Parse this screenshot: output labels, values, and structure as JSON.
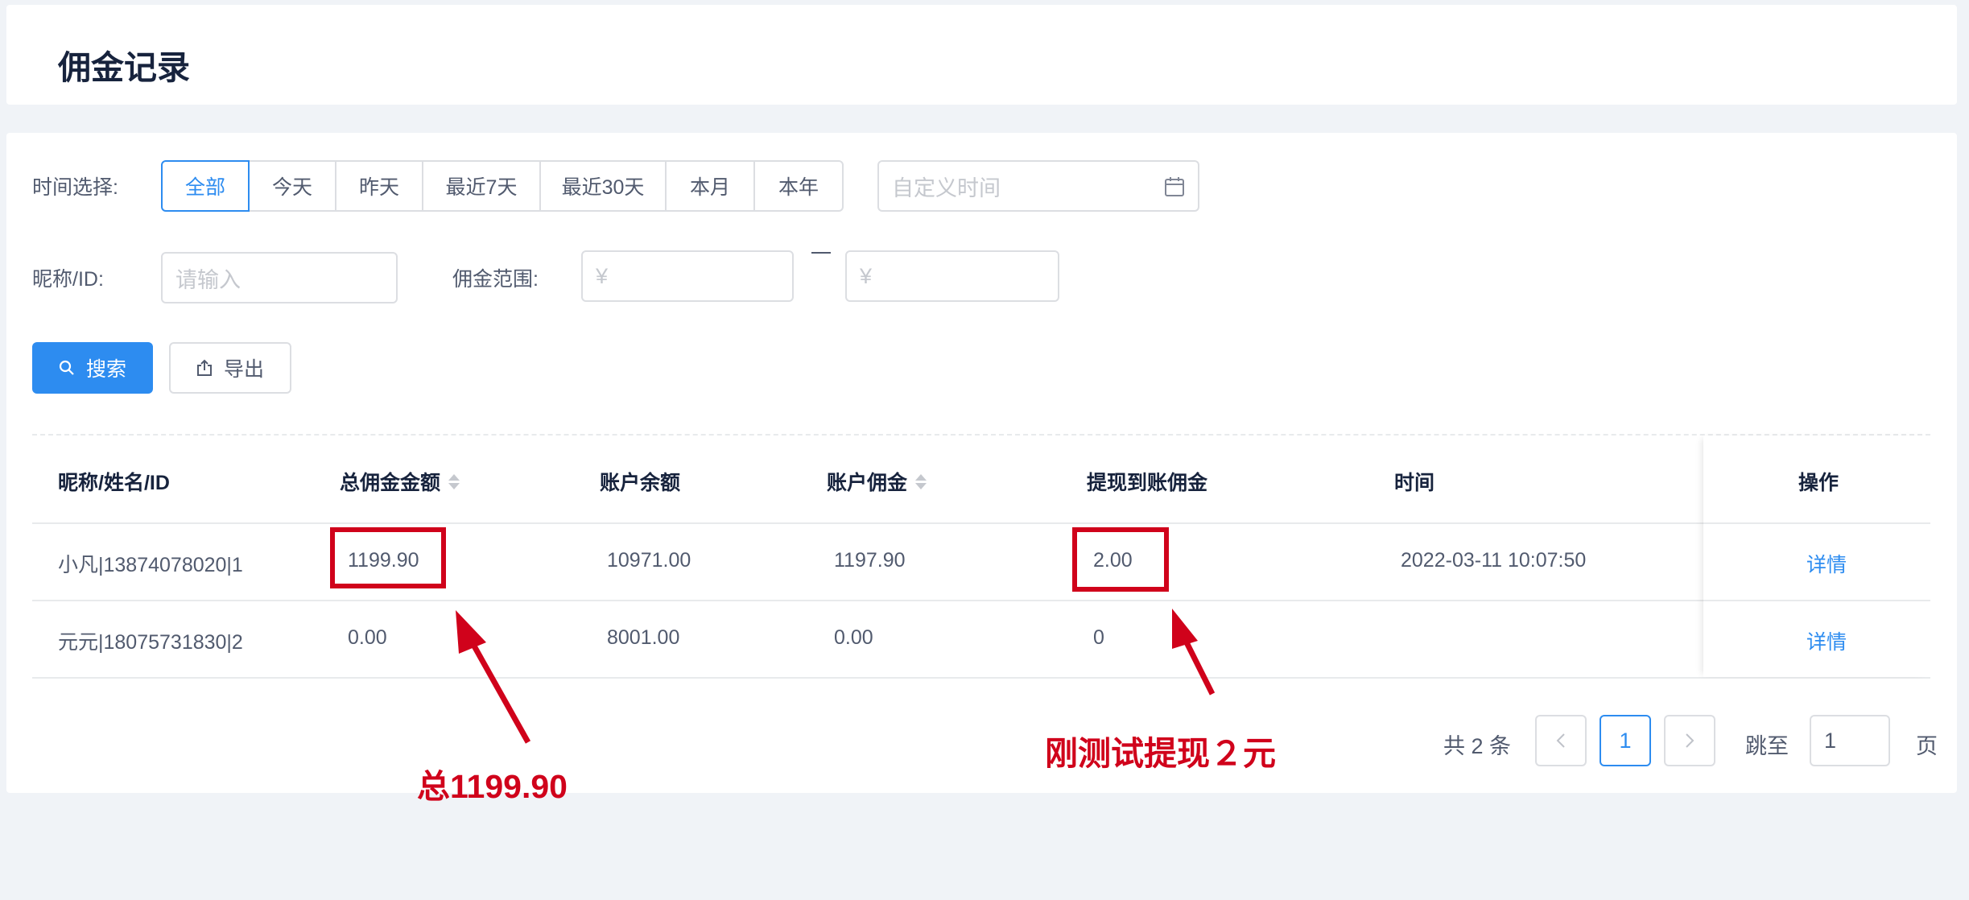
{
  "page": {
    "title": "佣金记录"
  },
  "filters": {
    "time_label": "时间选择:",
    "time_options": [
      "全部",
      "今天",
      "昨天",
      "最近7天",
      "最近30天",
      "本月",
      "本年"
    ],
    "time_selected": "全部",
    "custom_time_placeholder": "自定义时间",
    "nickname_label": "昵称/ID:",
    "nickname_placeholder": "请输入",
    "range_label": "佣金范围:",
    "range_min_placeholder": "¥",
    "range_max_placeholder": "¥"
  },
  "actions": {
    "search_label": "搜索",
    "export_label": "导出"
  },
  "table": {
    "columns": [
      "昵称/姓名/ID",
      "总佣金金额",
      "账户余额",
      "账户佣金",
      "提现到账佣金",
      "时间",
      "操作"
    ],
    "sortable_columns": [
      "总佣金金额",
      "账户佣金"
    ],
    "rows": [
      {
        "name": "小凡|13874078020|1",
        "total": "1199.90",
        "balance": "10971.00",
        "commission": "1197.90",
        "withdrawn": "2.00",
        "time": "2022-03-11 10:07:50",
        "action": "详情"
      },
      {
        "name": "元元|18075731830|2",
        "total": "0.00",
        "balance": "8001.00",
        "commission": "0.00",
        "withdrawn": "0",
        "time": "",
        "action": "详情"
      }
    ]
  },
  "pagination": {
    "total_text": "共 2 条",
    "current_page": "1",
    "jump_label": "跳至",
    "jump_value": "1",
    "page_suffix": "页"
  },
  "annotations": {
    "total_note": "总1199.90",
    "withdraw_note": "刚测试提现２元",
    "color": "#d0021b"
  },
  "colors": {
    "primary": "#2d8cf0",
    "background": "#f0f3f7"
  }
}
